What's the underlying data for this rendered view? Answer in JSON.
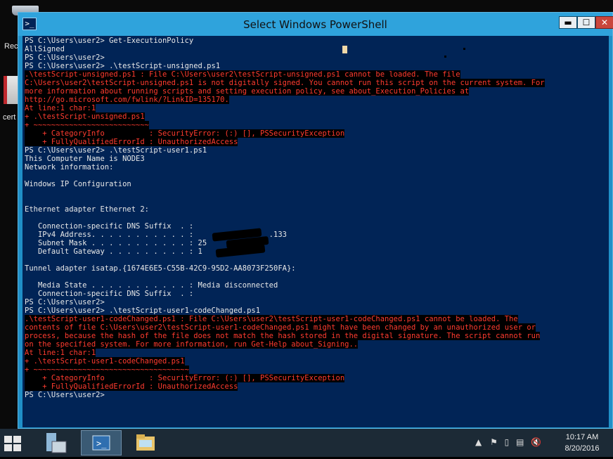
{
  "desktop": {
    "icons": [
      {
        "label": "Rec"
      },
      {
        "label": "cert"
      }
    ]
  },
  "window": {
    "title": "Select Windows PowerShell",
    "controls": {
      "minimize": "▬",
      "maximize": "☐",
      "close": "✕"
    }
  },
  "console": {
    "lines": [
      {
        "t": "PS C:\\Users\\user2> Get-ExecutionPolicy",
        "err": false
      },
      {
        "t": "AllSigned",
        "err": false
      },
      {
        "t": "PS C:\\Users\\user2>",
        "err": false
      },
      {
        "t": "PS C:\\Users\\user2> .\\testScript-unsigned.ps1",
        "err": false
      },
      {
        "t": ".\\testScript-unsigned.ps1 : File C:\\Users\\user2\\testScript-unsigned.ps1 cannot be loaded. The file",
        "err": true
      },
      {
        "t": "C:\\Users\\user2\\testScript-unsigned.ps1 is not digitally signed. You cannot run this script on the current system. For",
        "err": true
      },
      {
        "t": "more information about running scripts and setting execution policy, see about_Execution_Policies at",
        "err": true
      },
      {
        "t": "http://go.microsoft.com/fwlink/?LinkID=135170.",
        "err": true
      },
      {
        "t": "At line:1 char:1",
        "err": true
      },
      {
        "t": "+ .\\testScript-unsigned.ps1",
        "err": true
      },
      {
        "t": "+ ~~~~~~~~~~~~~~~~~~~~~~~~~~",
        "err": true
      },
      {
        "t": "    + CategoryInfo          : SecurityError: (:) [], PSSecurityException",
        "err": true
      },
      {
        "t": "    + FullyQualifiedErrorId : UnauthorizedAccess",
        "err": true
      },
      {
        "t": "PS C:\\Users\\user2> .\\testScript-user1.ps1",
        "err": false
      },
      {
        "t": "This Computer Name is NODE3",
        "err": false
      },
      {
        "t": "Network information:",
        "err": false
      },
      {
        "t": "",
        "err": false
      },
      {
        "t": "Windows IP Configuration",
        "err": false
      },
      {
        "t": "",
        "err": false
      },
      {
        "t": "",
        "err": false
      },
      {
        "t": "Ethernet adapter Ethernet 2:",
        "err": false
      },
      {
        "t": "",
        "err": false
      },
      {
        "t": "   Connection-specific DNS Suffix  . :",
        "err": false
      },
      {
        "t": "   IPv4 Address. . . . . . . . . . . :                 .133",
        "err": false
      },
      {
        "t": "   Subnet Mask . . . . . . . . . . . : 25       5.0",
        "err": false
      },
      {
        "t": "   Default Gateway . . . . . . . . . : 1         1",
        "err": false
      },
      {
        "t": "",
        "err": false
      },
      {
        "t": "Tunnel adapter isatap.{1674E6E5-C55B-42C9-95D2-AA8073F250FA}:",
        "err": false
      },
      {
        "t": "",
        "err": false
      },
      {
        "t": "   Media State . . . . . . . . . . . : Media disconnected",
        "err": false
      },
      {
        "t": "   Connection-specific DNS Suffix  . :",
        "err": false
      },
      {
        "t": "PS C:\\Users\\user2>",
        "err": false
      },
      {
        "t": "PS C:\\Users\\user2> .\\testScript-user1-codeChanged.ps1",
        "err": false
      },
      {
        "t": ".\\testScript-user1-codeChanged.ps1 : File C:\\Users\\user2\\testScript-user1-codeChanged.ps1 cannot be loaded. The",
        "err": true
      },
      {
        "t": "contents of file C:\\Users\\user2\\testScript-user1-codeChanged.ps1 might have been changed by an unauthorized user or",
        "err": true
      },
      {
        "t": "process, because the hash of the file does not match the hash stored in the digital signature. The script cannot run",
        "err": true
      },
      {
        "t": "on the specified system. For more information, run Get-Help about_Signing..",
        "err": true
      },
      {
        "t": "At line:1 char:1",
        "err": true
      },
      {
        "t": "+ .\\testScript-user1-codeChanged.ps1",
        "err": true
      },
      {
        "t": "+ ~~~~~~~~~~~~~~~~~~~~~~~~~~~~~~~~~~~",
        "err": true
      },
      {
        "t": "    + CategoryInfo          : SecurityError: (:) [], PSSecurityException",
        "err": true
      },
      {
        "t": "    + FullyQualifiedErrorId : UnauthorizedAccess",
        "err": true
      },
      {
        "t": "PS C:\\Users\\user2>",
        "err": false
      }
    ]
  },
  "taskbar": {
    "items": [
      {
        "name": "start-button-icon"
      },
      {
        "name": "server-manager-icon"
      },
      {
        "name": "powershell-icon"
      },
      {
        "name": "file-explorer-icon"
      }
    ],
    "tray_icons": [
      "▲",
      "⚑",
      "▯",
      "▤",
      "🔇"
    ],
    "clock": {
      "time": "10:17 AM",
      "date": "8/20/2016"
    }
  },
  "colors": {
    "console_bg": "#012456",
    "error_text": "#ff3b2f",
    "titlebar": "#2fa3dc"
  }
}
